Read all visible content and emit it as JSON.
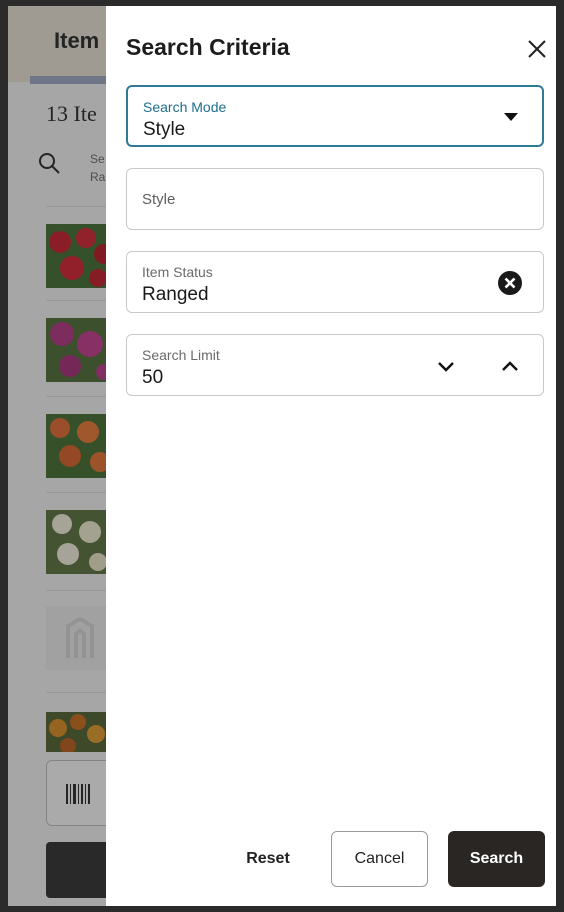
{
  "background": {
    "title": "Item",
    "count": "13 Ite",
    "search_line1": "Se",
    "search_line2": "Ra"
  },
  "drawer": {
    "title": "Search Criteria",
    "fields": {
      "search_mode": {
        "label": "Search Mode",
        "value": "Style"
      },
      "style": {
        "placeholder": "Style",
        "value": ""
      },
      "item_status": {
        "label": "Item Status",
        "value": "Ranged"
      },
      "search_limit": {
        "label": "Search Limit",
        "value": "50"
      }
    },
    "buttons": {
      "reset": "Reset",
      "cancel": "Cancel",
      "search": "Search"
    }
  },
  "colors": {
    "accent": "#2f7a95",
    "primary_button": "#2a2624"
  }
}
